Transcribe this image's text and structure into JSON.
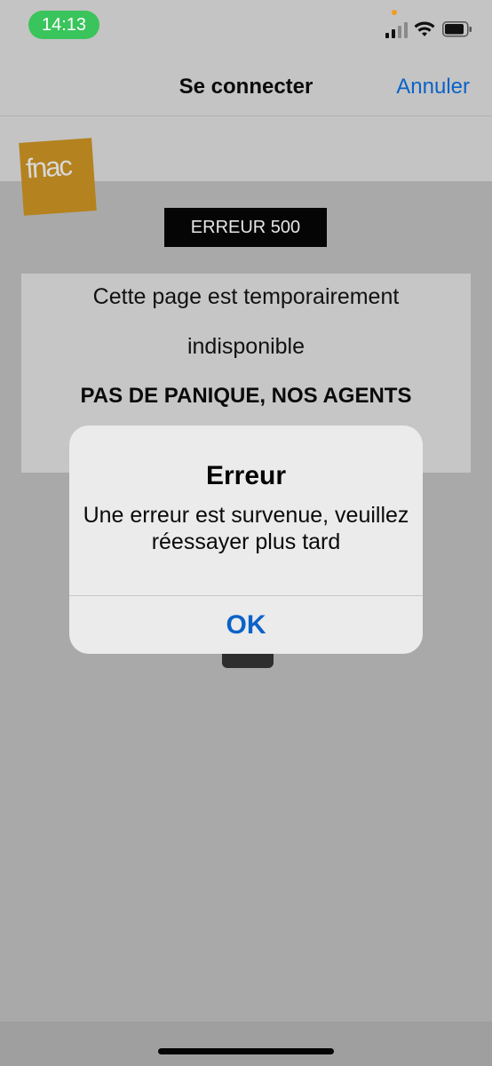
{
  "status_bar": {
    "time": "14:13",
    "icons": [
      "signal-icon",
      "wifi-icon",
      "battery-icon"
    ]
  },
  "nav": {
    "title": "Se connecter",
    "cancel_label": "Annuler"
  },
  "page": {
    "logo_text": "fnac",
    "error_badge": "ERREUR 500",
    "message_line1": "Cette page est temporairement",
    "message_line2": "indisponible",
    "message_line3": "PAS DE PANIQUE, NOS AGENTS"
  },
  "alert": {
    "title": "Erreur",
    "message": "Une erreur est survenue, veuillez réessayer plus tard",
    "ok_label": "OK"
  },
  "colors": {
    "accent": "#0a63c8",
    "time_pill": "#3ac45c",
    "logo": "#b4821f"
  }
}
